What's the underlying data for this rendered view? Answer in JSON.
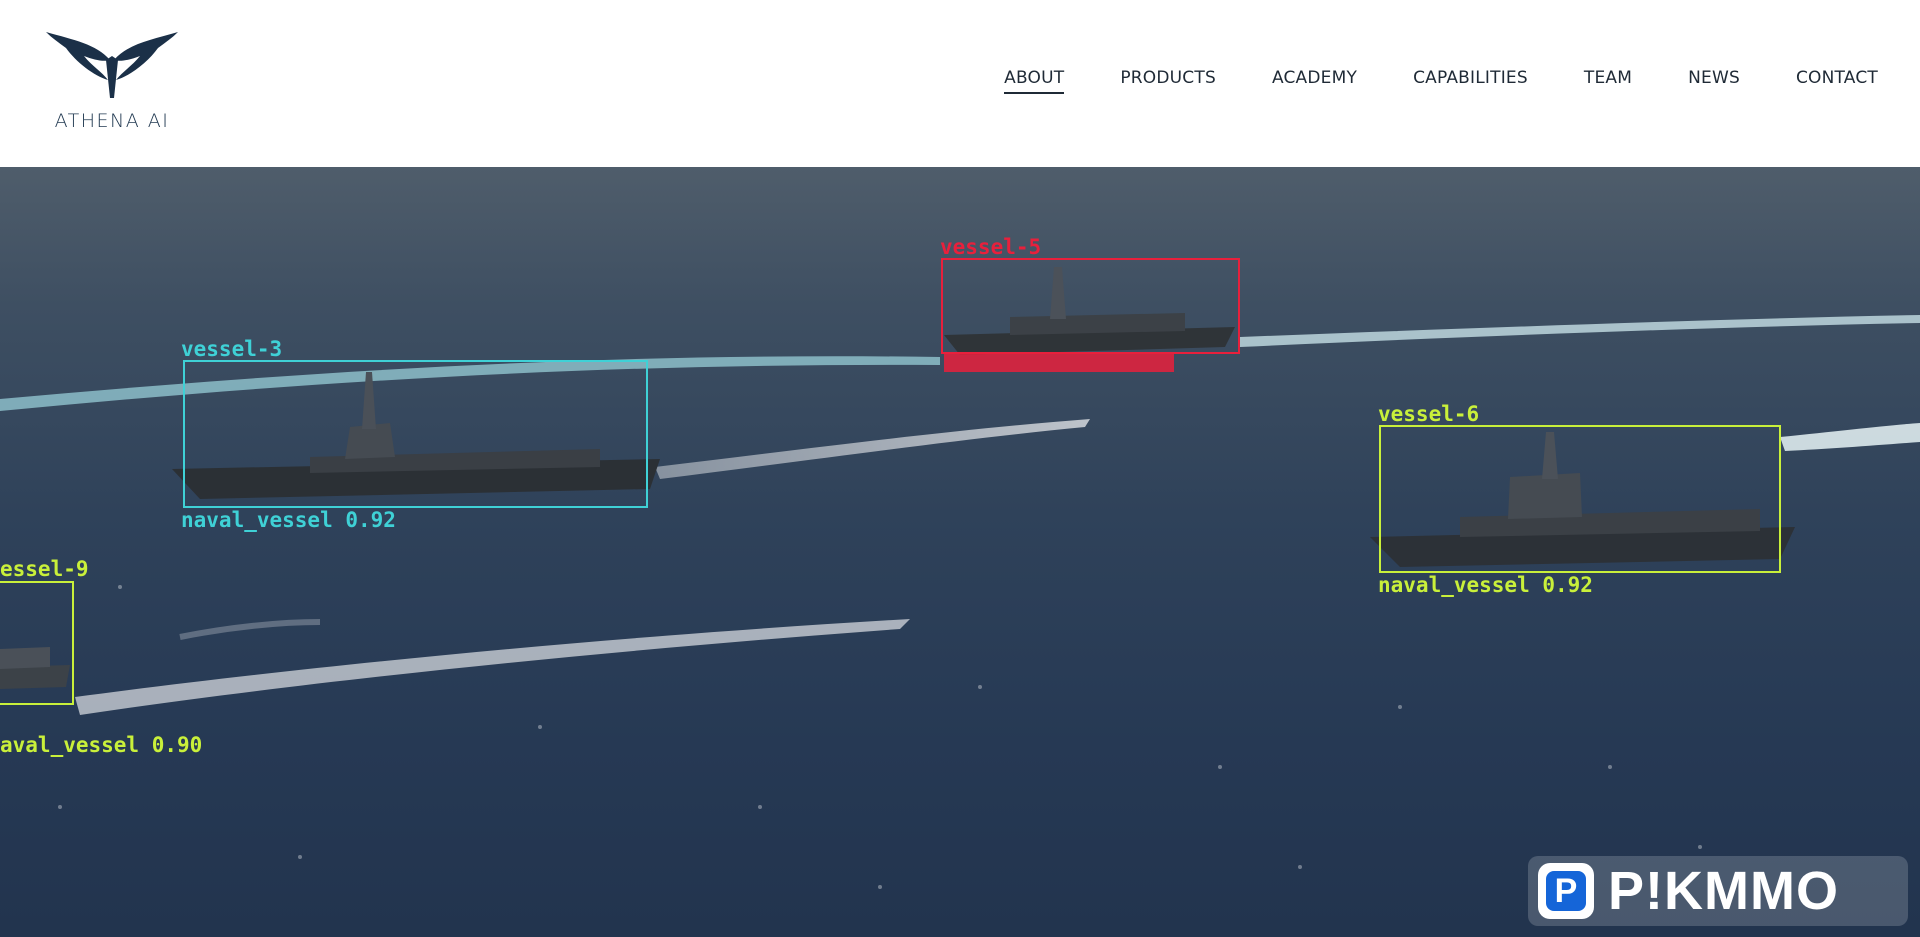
{
  "brand": {
    "name": "ATHENA AI",
    "logo_icon": "athena-wings-icon",
    "color": "#1b3048"
  },
  "nav": {
    "items": [
      {
        "label": "ABOUT",
        "active": true
      },
      {
        "label": "PRODUCTS"
      },
      {
        "label": "ACADEMY"
      },
      {
        "label": "CAPABILITIES"
      },
      {
        "label": "TEAM"
      },
      {
        "label": "NEWS"
      },
      {
        "label": "CONTACT"
      }
    ]
  },
  "hero": {
    "detections": [
      {
        "id": "vessel-3",
        "caption": "naval_vessel 0.92",
        "color": "#3fd1d6"
      },
      {
        "id": "vessel-5",
        "caption": "",
        "color": "#e8203c"
      },
      {
        "id": "vessel-6",
        "caption": "naval_vessel 0.92",
        "color": "#c9f03a"
      },
      {
        "id": "essel-9",
        "caption": "aval_vessel 0.90",
        "color": "#c9f03a"
      }
    ]
  },
  "watermark": {
    "badge": "P",
    "text": "P!KMMO"
  }
}
